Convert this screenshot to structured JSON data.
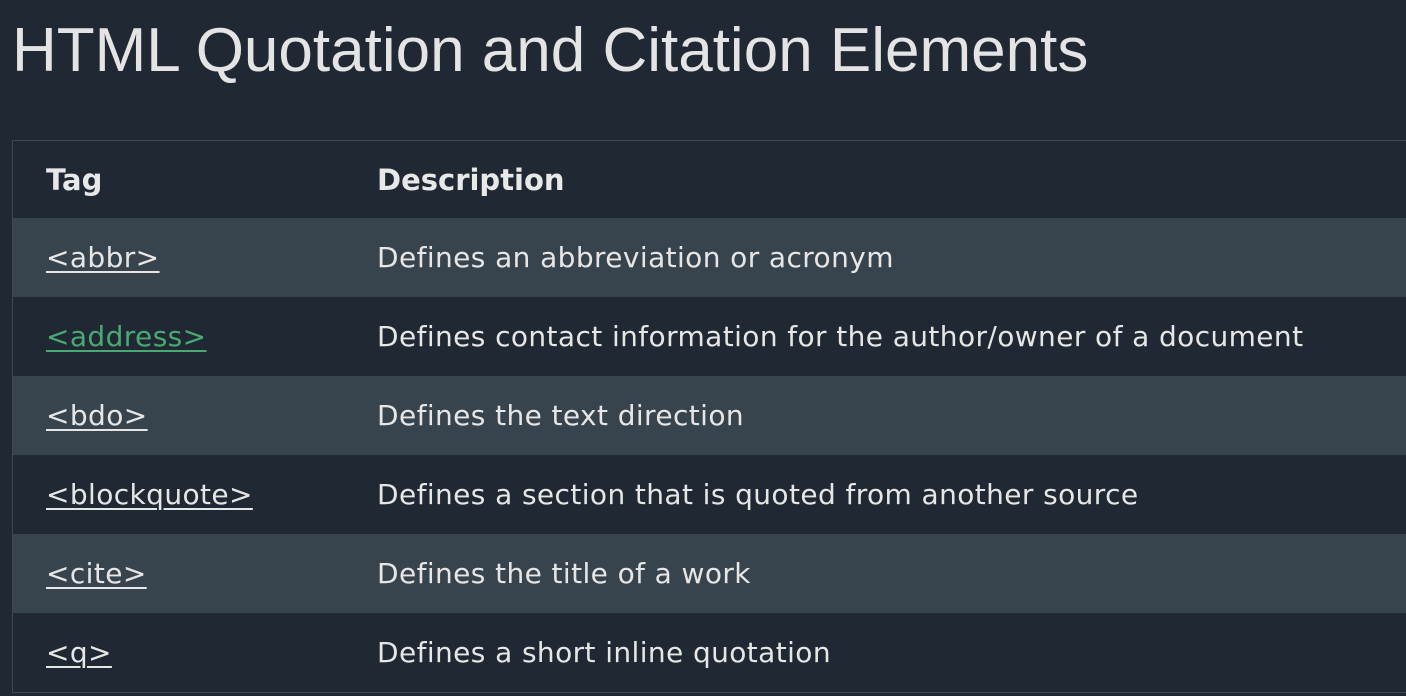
{
  "page": {
    "title": "HTML Quotation and Citation Elements"
  },
  "table": {
    "headers": {
      "tag": "Tag",
      "description": "Description"
    },
    "rows": [
      {
        "tag": "<abbr>",
        "description": "Defines an abbreviation or acronym"
      },
      {
        "tag": "<address>",
        "description": "Defines contact information for the author/owner of a document"
      },
      {
        "tag": "<bdo>",
        "description": "Defines the text direction"
      },
      {
        "tag": "<blockquote>",
        "description": "Defines a section that is quoted from another source"
      },
      {
        "tag": "<cite>",
        "description": "Defines the title of a work"
      },
      {
        "tag": "<q>",
        "description": "Defines a short inline quotation"
      }
    ]
  },
  "colors": {
    "background": "#1f2833",
    "row_stripe": "#38444d",
    "link": "#e6e6e6",
    "link_visited": "#4aa872"
  }
}
